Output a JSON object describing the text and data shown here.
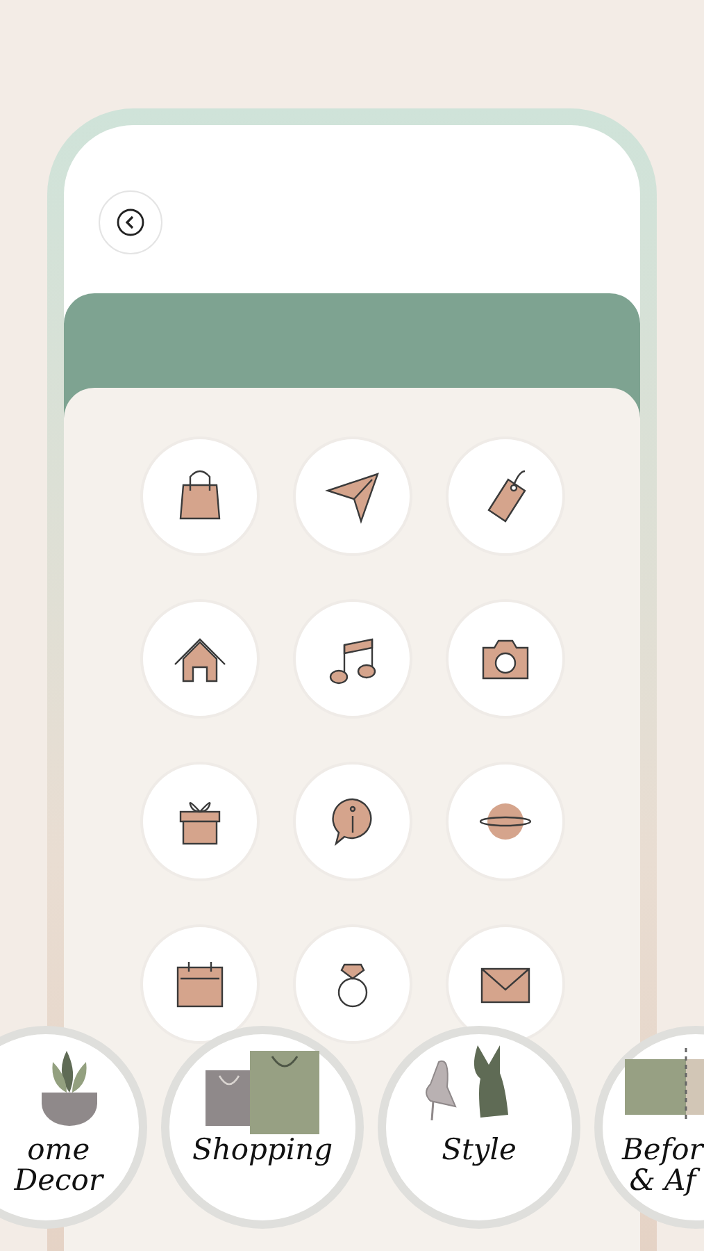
{
  "icon_grid": [
    {
      "kind": "bag"
    },
    {
      "kind": "plane"
    },
    {
      "kind": "tag"
    },
    {
      "kind": "house"
    },
    {
      "kind": "music"
    },
    {
      "kind": "camera"
    },
    {
      "kind": "gift"
    },
    {
      "kind": "info"
    },
    {
      "kind": "planet"
    },
    {
      "kind": "calendar"
    },
    {
      "kind": "ring"
    },
    {
      "kind": "envelope"
    }
  ],
  "highlights": [
    {
      "kind": "plant",
      "lines": [
        "ome",
        "Decor"
      ]
    },
    {
      "kind": "bags",
      "lines": [
        "Shopping"
      ]
    },
    {
      "kind": "fashion",
      "lines": [
        "Style"
      ]
    },
    {
      "kind": "swatch",
      "lines": [
        "Befor",
        "& Af"
      ]
    }
  ]
}
